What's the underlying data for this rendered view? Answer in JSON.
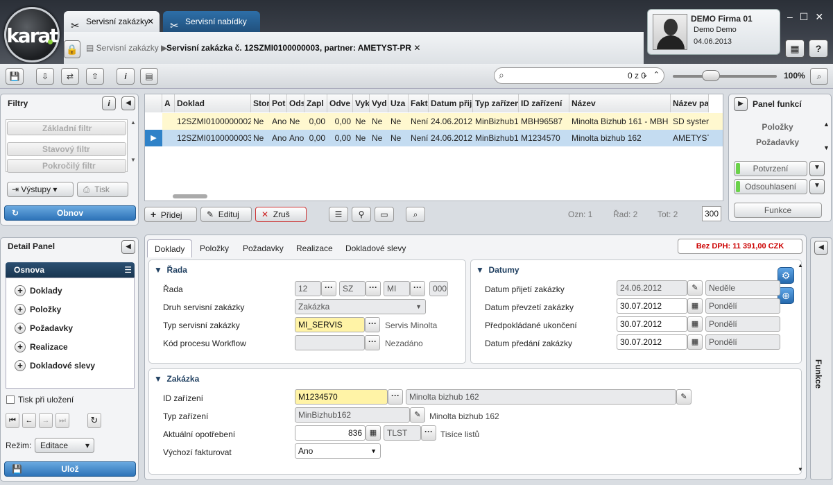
{
  "app": {
    "logo_text": "karat"
  },
  "tabs": [
    {
      "label": "Servisní zakázky",
      "close": "✕"
    },
    {
      "label": "Servisní nabídky"
    }
  ],
  "breadcrumb": {
    "parent": "Servisní zakázky",
    "current": "Servisní zakázka č. 12SZMI0100000003, partner: AMETYST-PR",
    "close": "✕"
  },
  "user": {
    "company": "DEMO Firma 01",
    "name": "Demo Demo",
    "date": "04.06.2013"
  },
  "window_controls": {
    "minimize": "–",
    "maximize": "☐",
    "close": "✕"
  },
  "search": {
    "placeholder": "",
    "counter": "0 z 0"
  },
  "zoom": "100%",
  "filters": {
    "title": "Filtry",
    "basic": "Základní filtr",
    "state": "Stavový filtr",
    "advanced": "Pokročilý filtr",
    "outputs": "Výstupy",
    "print": "Tisk",
    "refresh": "Obnov"
  },
  "grid": {
    "headers": [
      "A",
      "Doklad",
      "Stor",
      "Pot",
      "Ods",
      "Zapl",
      "Odve",
      "Vyk",
      "Vyd",
      "Uza",
      "Fakt",
      "Datum přij",
      "Typ zařízen",
      "ID zařízení",
      "Název",
      "Název pa"
    ],
    "rows": [
      [
        "",
        "12SZMI0100000002",
        "Ne",
        "Ano",
        "Ne",
        "0,00",
        "0,00",
        "Ne",
        "Ne",
        "Ne",
        "Není",
        "24.06.2012",
        "MinBizhub1",
        "MBH96587",
        "Minolta Bizhub 161 - MBH",
        "SD system"
      ],
      [
        "",
        "12SZMI0100000003",
        "Ne",
        "Ano",
        "Ano",
        "0,00",
        "0,00",
        "Ne",
        "Ne",
        "Ne",
        "Není",
        "24.06.2012",
        "MinBizhub1",
        "M1234570",
        "Minolta bizhub 162",
        "AMETYST"
      ]
    ],
    "buttons": {
      "add": "Přidej",
      "edit": "Edituj",
      "cancel": "Zruš"
    },
    "status": {
      "marked": "Ozn: 1",
      "row": "Řad: 2",
      "total": "Tot: 2",
      "page_size": "300"
    }
  },
  "panel_funkci": {
    "title": "Panel funkcí",
    "items": [
      "Položky",
      "Požadavky"
    ],
    "confirm": "Potvrzení",
    "reject": "Odsouhlasení",
    "functions": "Funkce"
  },
  "detail_panel": {
    "title": "Detail Panel",
    "outline": "Osnova",
    "items": [
      "Doklady",
      "Položky",
      "Požadavky",
      "Realizace",
      "Dokladové slevy"
    ],
    "print_on_save": "Tisk při uložení",
    "mode_label": "Režim:",
    "mode_value": "Editace",
    "save": "Ulož"
  },
  "detail_tabs": [
    "Doklady",
    "Položky",
    "Požadavky",
    "Realizace",
    "Dokladové slevy"
  ],
  "vat": "Bez DPH:  11 391,00 CZK",
  "rada": {
    "title": "Řada",
    "label_rada": "Řada",
    "r1": "12",
    "r2": "SZ",
    "r3": "MI",
    "r4": "000",
    "label_druh": "Druh servisní zakázky",
    "druh": "Zakázka",
    "label_typ": "Typ servisní zakázky",
    "typ": "MI_SERVIS",
    "typ_desc": "Servis Minolta",
    "label_kod": "Kód procesu Workflow",
    "kod": "",
    "kod_desc": "Nezadáno"
  },
  "datumy": {
    "title": "Datumy",
    "l1": "Datum přijetí zakázky",
    "v1": "24.06.2012",
    "d1": "Neděle",
    "l2": "Datum převzetí zakázky",
    "v2": "30.07.2012",
    "d2": "Pondělí",
    "l3": "Předpokládané ukončení",
    "v3": "30.07.2012",
    "d3": "Pondělí",
    "l4": "Datum předání zakázky",
    "v4": "30.07.2012",
    "d4": "Pondělí"
  },
  "zakazka": {
    "title": "Zakázka",
    "l1": "ID zařízení",
    "v1": "M1234570",
    "n1": "Minolta bizhub 162",
    "l2": "Typ zařízení",
    "v2": "MinBizhub162",
    "n2": "Minolta bizhub 162",
    "l3": "Aktuální opotřebení",
    "v3": "836",
    "u3": "TLST",
    "u3_desc": "Tisíce listů",
    "l4": "Výchozí fakturovat",
    "v4": "Ano"
  },
  "side_functions": "Funkce"
}
